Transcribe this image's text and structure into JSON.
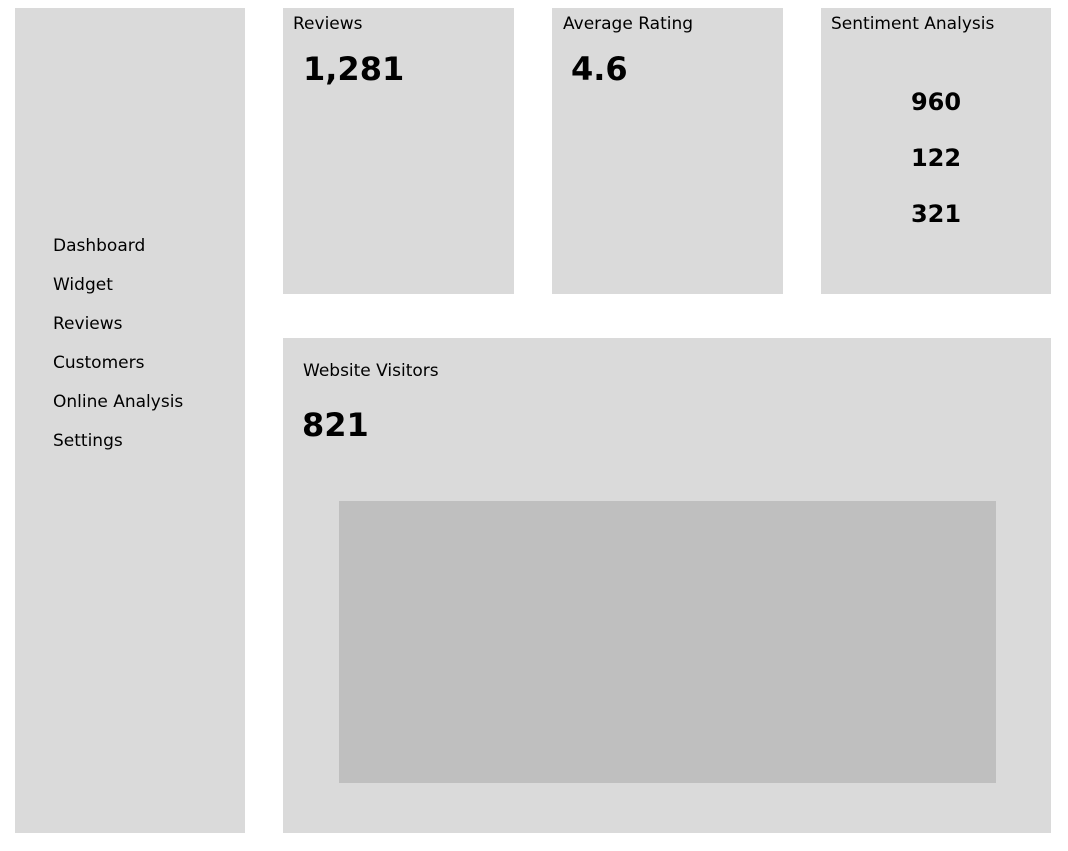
{
  "sidebar": {
    "items": [
      {
        "label": "Dashboard"
      },
      {
        "label": "Widget"
      },
      {
        "label": "Reviews"
      },
      {
        "label": "Customers"
      },
      {
        "label": "Online Analysis"
      },
      {
        "label": "Settings"
      }
    ]
  },
  "cards": {
    "reviews": {
      "title": "Reviews",
      "value": "1,281"
    },
    "rating": {
      "title": "Average Rating",
      "value": "4.6"
    },
    "sentiment": {
      "title": "Sentiment Analysis",
      "values": [
        "960",
        "122",
        "321"
      ]
    },
    "visitors": {
      "title": "Website Visitors",
      "value": "821"
    }
  },
  "colors": {
    "panel_bg": "#dadada",
    "chart_placeholder_bg": "#bfbfbf",
    "text": "#000000"
  }
}
